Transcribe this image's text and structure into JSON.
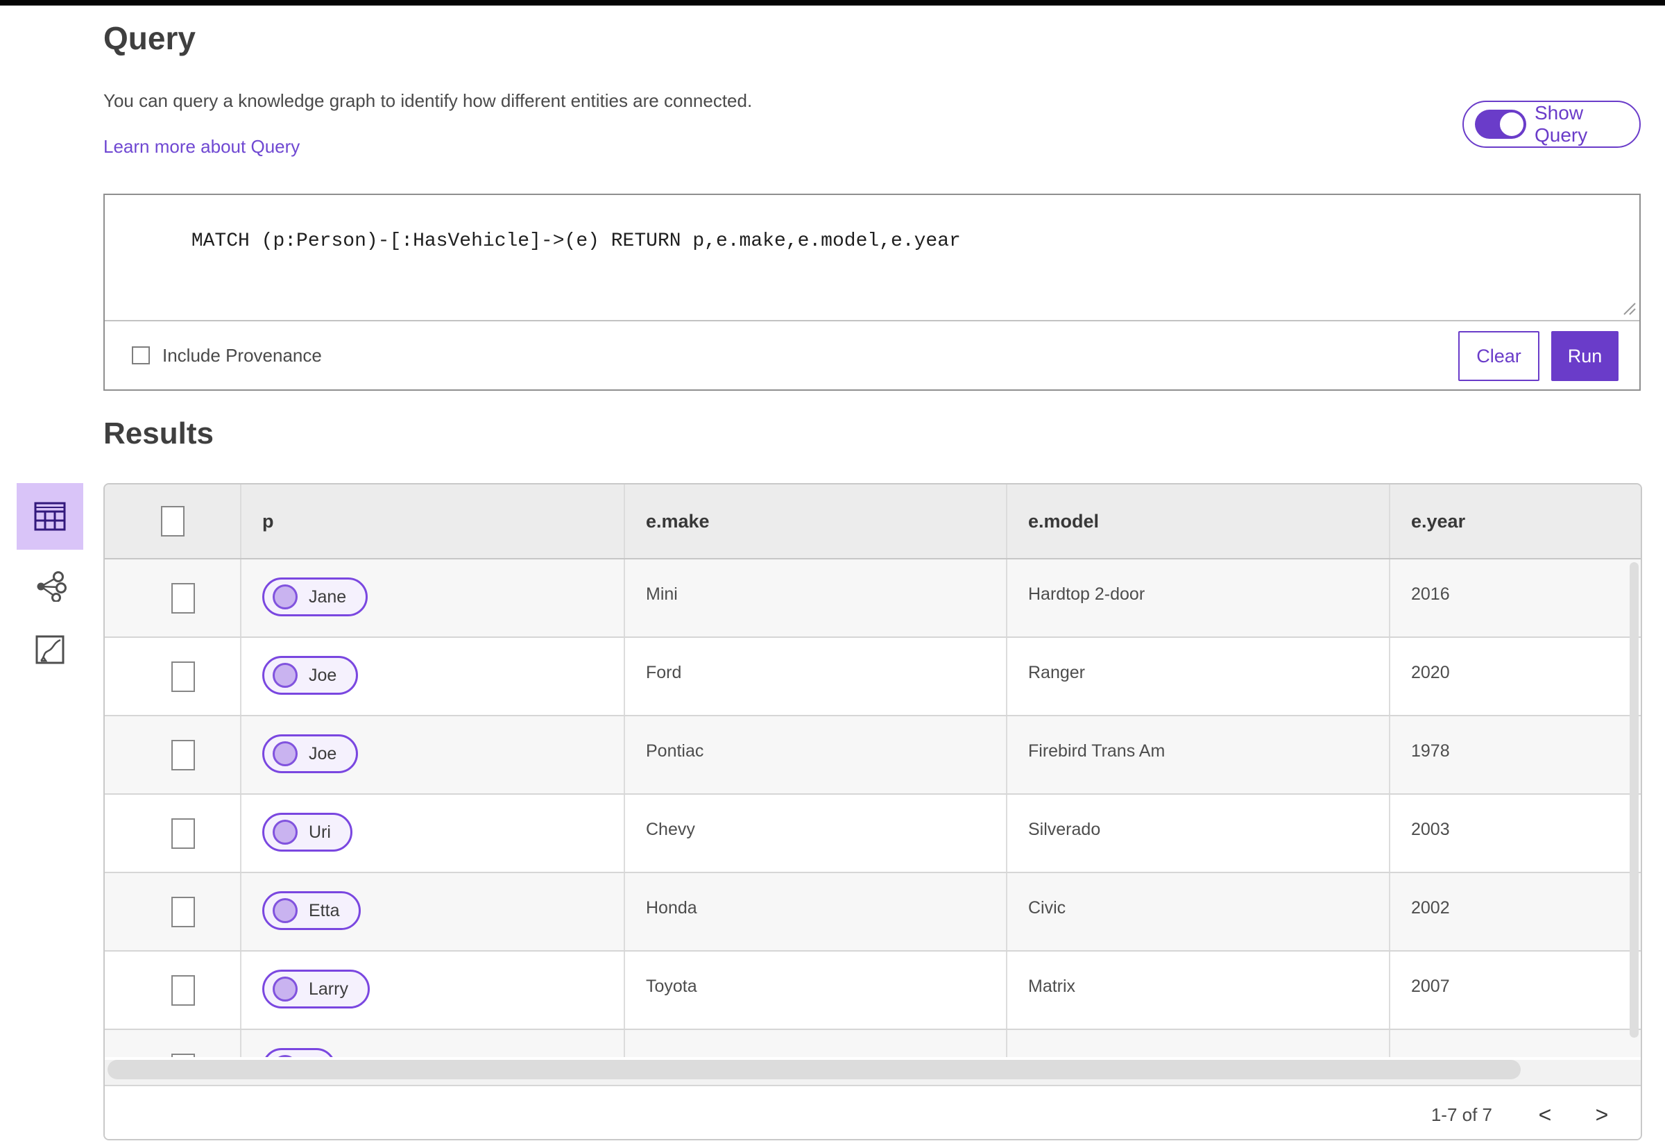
{
  "page": {
    "title": "Query",
    "description": "You can query a knowledge graph to identify how different entities are connected.",
    "learn_more": "Learn more about Query",
    "show_query_label": "Show Query",
    "show_query_on": true
  },
  "query_editor": {
    "text": "MATCH (p:Person)-[:HasVehicle]->(e) RETURN p,e.make,e.model,e.year",
    "include_provenance_label": "Include Provenance",
    "include_provenance_checked": false,
    "clear_label": "Clear",
    "run_label": "Run"
  },
  "results": {
    "heading": "Results",
    "view_icons": [
      "table-view-icon",
      "link-chart-view-icon",
      "map-view-icon"
    ],
    "selected_view": "table-view-icon",
    "table": {
      "columns": [
        "p",
        "e.make",
        "e.model",
        "e.year"
      ],
      "rows": [
        {
          "p": "Jane",
          "make": "Mini",
          "model": "Hardtop 2-door",
          "year": "2016"
        },
        {
          "p": "Joe",
          "make": "Ford",
          "model": "Ranger",
          "year": "2020"
        },
        {
          "p": "Joe",
          "make": "Pontiac",
          "model": "Firebird Trans Am",
          "year": "1978"
        },
        {
          "p": "Uri",
          "make": "Chevy",
          "model": "Silverado",
          "year": "2003"
        },
        {
          "p": "Etta",
          "make": "Honda",
          "model": "Civic",
          "year": "2002"
        },
        {
          "p": "Larry",
          "make": "Toyota",
          "model": "Matrix",
          "year": "2007"
        }
      ],
      "partial_row_visible": true
    },
    "pagination": {
      "label": "1-7 of 7",
      "prev": "<",
      "next": ">"
    }
  },
  "colors": {
    "accent": "#6a3cc9",
    "pill_border": "#7a47e0",
    "pill_background": "#f5f1fd",
    "selected_tile_background": "#d9c4f8",
    "header_background": "#ececec",
    "alt_row_background": "#f7f7f7",
    "top_strip": "#050505"
  }
}
